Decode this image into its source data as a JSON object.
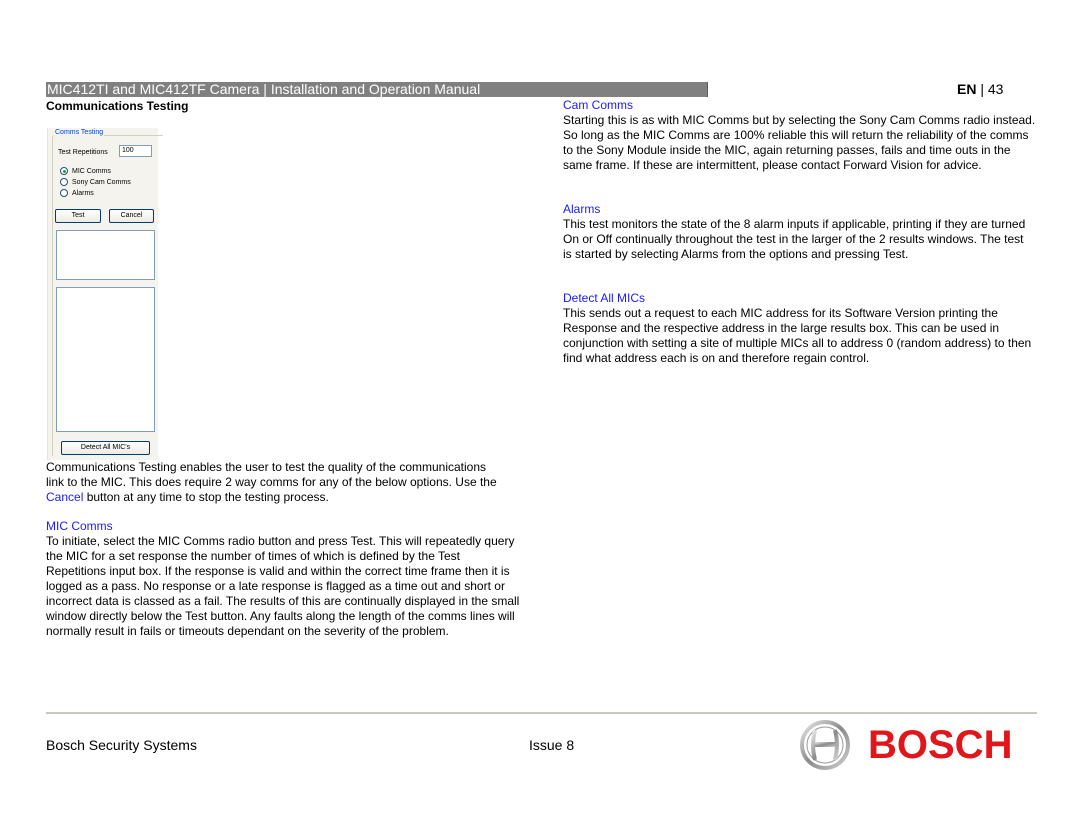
{
  "header": {
    "title": "MIC412TI and MIC412TF Camera | Installation and Operation Manual",
    "lang": "EN",
    "separator": "|",
    "page_number": "43"
  },
  "section_title": "Communications Testing",
  "dialog": {
    "group_label": "Comms Testing",
    "repetitions_label": "Test Repetitions",
    "repetitions_value": "100",
    "radio_options": [
      {
        "label": "MIC Comms",
        "selected": true
      },
      {
        "label": "Sony Cam Comms",
        "selected": false
      },
      {
        "label": "Alarms",
        "selected": false
      }
    ],
    "test_button": "Test",
    "cancel_button": "Cancel",
    "detect_button": "Detect All MIC's"
  },
  "left_column": {
    "intro_part1": "Communications Testing enables the user to test the quality of the communications link to the MIC. This does require 2 way comms for any of the below options. Use the ",
    "intro_link": "Cancel",
    "intro_part2": " button at any time to stop the testing process.",
    "mic_comms_heading": "MIC Comms",
    "mic_comms_body": "To initiate, select the MIC Comms radio button and press Test. This will repeatedly query the MIC for a set response the number of times of which is defined by the Test Repetitions input box. If the response is valid and within the correct time frame then it is logged as a pass. No response or a late response is flagged as a time out and short or incorrect data is classed as a fail. The results of this are continually displayed in the small window directly below the Test button. Any faults along the length of the comms lines will normally result in fails or timeouts dependant on the severity of the problem."
  },
  "right_column": {
    "sections": [
      {
        "heading": "Cam Comms",
        "body": "Starting this is as with MIC Comms but by selecting the Sony Cam Comms radio instead. So long as the MIC Comms are 100% reliable this will return the reliability of the comms to the Sony Module inside the MIC, again returning passes, fails and time outs in the same frame. If these are intermittent, please contact Forward Vision for advice."
      },
      {
        "heading": "Alarms",
        "body": "This test monitors the state of the 8 alarm inputs if applicable, printing if they are turned On or Off continually throughout the test in the larger of the 2 results windows. The test is started by selecting Alarms from the options and pressing Test."
      },
      {
        "heading": "Detect All MICs",
        "body": "This sends out a request to each MIC address for its Software Version printing the Response and the respective address in the large results box. This can be used in conjunction with setting a site of multiple MICs all to address 0 (random address) to then find what address each is on and therefore regain control."
      }
    ]
  },
  "footer": {
    "company": "Bosch Security Systems",
    "issue": "Issue 8",
    "logo_text": "BOSCH"
  },
  "colors": {
    "header_bar": "#808080",
    "link_blue": "#1a1aff",
    "bosch_red": "#e0161b"
  }
}
